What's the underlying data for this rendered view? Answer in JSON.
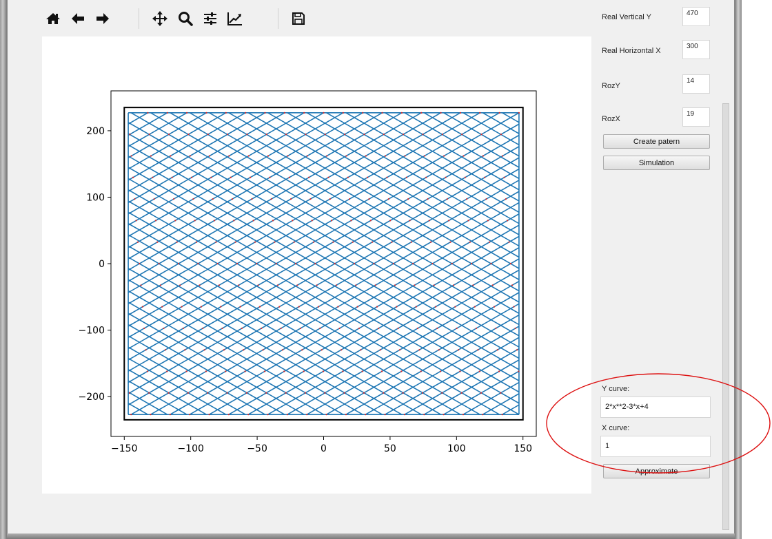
{
  "toolbar": {
    "icons": [
      "home-icon",
      "back-arrow-icon",
      "forward-arrow-icon",
      "pan-icon",
      "zoom-icon",
      "configure-subplots-icon",
      "edit-axis-icon",
      "save-icon"
    ]
  },
  "fields": {
    "real_vertical_y": {
      "label": "Real Vertical Y",
      "value": "470"
    },
    "real_horizontal_x": {
      "label": "Real Horizontal X",
      "value": "300"
    },
    "roz_y": {
      "label": "RozY",
      "value": "14"
    },
    "roz_x": {
      "label": "RozX",
      "value": "19"
    }
  },
  "buttons": {
    "create_pattern": "Create patern",
    "simulation": "Simulation",
    "approximate": "Approximate"
  },
  "curves": {
    "y_label": "Y curve:",
    "y_value": "2*x**2-3*x+4",
    "x_label": "X curve:",
    "x_value": "1"
  },
  "chart_data": {
    "type": "line",
    "title": "",
    "xlabel": "",
    "ylabel": "",
    "xlim": [
      -160,
      160
    ],
    "ylim": [
      -260,
      260
    ],
    "xticks": [
      -150,
      -100,
      -50,
      0,
      50,
      100,
      150
    ],
    "yticks": [
      -200,
      -100,
      0,
      100,
      200
    ],
    "xtick_labels": [
      "−150",
      "−100",
      "−50",
      "0",
      "50",
      "100",
      "150"
    ],
    "ytick_labels": [
      "−200",
      "−100",
      "0",
      "100",
      "200"
    ],
    "boundary": {
      "x": [
        -150,
        150
      ],
      "y": [
        -235,
        235
      ]
    },
    "pattern": {
      "x_range": [
        -147,
        147
      ],
      "y_range": [
        -227,
        227
      ],
      "roz_x": 19,
      "roz_y": 14
    },
    "colors": {
      "lines": "#1f77b4",
      "points": "#d62728",
      "boundary": "#000000"
    }
  }
}
